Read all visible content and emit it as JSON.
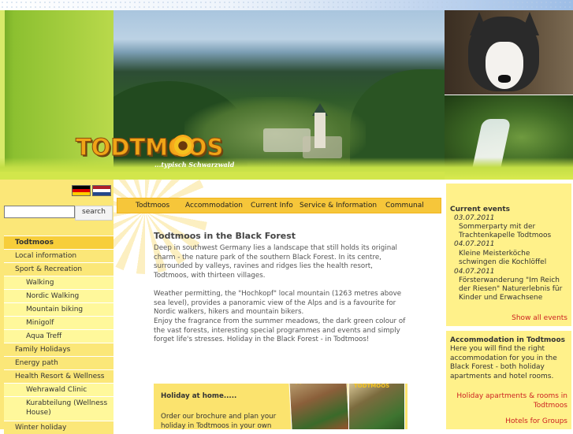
{
  "header": {
    "logo_text": "TODTMOOS",
    "tagline": "...typisch Schwarzwald"
  },
  "languages": [
    {
      "code": "de",
      "label": "German"
    },
    {
      "code": "nl",
      "label": "Dutch"
    }
  ],
  "search": {
    "placeholder": "",
    "button_label": "search"
  },
  "top_nav": [
    "Todtmoos",
    "Accommodation",
    "Current Info",
    "Service & Information",
    "Communal"
  ],
  "side_nav": [
    {
      "label": "Todtmoos",
      "level": 0,
      "active": true
    },
    {
      "label": "Local information",
      "level": 0
    },
    {
      "label": "Sport & Recreation",
      "level": 0
    },
    {
      "label": "Walking",
      "level": 1
    },
    {
      "label": "Nordic Walking",
      "level": 1
    },
    {
      "label": "Mountain biking",
      "level": 1
    },
    {
      "label": "Minigolf",
      "level": 1
    },
    {
      "label": "Aqua Treff",
      "level": 1
    },
    {
      "label": "Family Holidays",
      "level": 0
    },
    {
      "label": "Energy path",
      "level": 0
    },
    {
      "label": "Health Resort & Wellness",
      "level": 0
    },
    {
      "label": "Wehrawald Clinic",
      "level": 1
    },
    {
      "label": "Kurabteilung (Wellness House)",
      "level": 1
    },
    {
      "label": "Winter holiday",
      "level": 0
    }
  ],
  "main": {
    "title": "Todtmoos in the Black Forest",
    "paragraphs": [
      "Deep in southwest Germany lies a landscape that still holds its original charm - the nature park of the southern Black Forest. In its centre, surrounded by valleys, ravines and ridges lies the health resort, Todtmoos, with thirteen villages.",
      "Weather permitting, the \"Hochkopf\" local mountain (1263 metres above sea level), provides a panoramic view of the Alps and is a favourite for Nordic walkers, hikers and mountain bikers.",
      "Enjoy the fragrance from the summer meadows, the dark green colour of the vast forests, interesting special programmes and events and simply forget life's stresses. Holiday in the Black Forest - in Todtmoos!"
    ],
    "holiday_box": {
      "title": "Holiday at home.....",
      "text": "Order our brochure and plan your holiday in Todtmoos in your own time..."
    }
  },
  "events": {
    "heading": "Current events",
    "items": [
      {
        "date": "03.07.2011",
        "title": "Sommerparty mit der Trachtenkapelle Todtmoos"
      },
      {
        "date": "04.07.2011",
        "title": "Kleine Meisterköche schwingen die Kochlöffel"
      },
      {
        "date": "04.07.2011",
        "title": "Försterwanderung \"Im Reich der Riesen\" Naturerlebnis für Kinder und Erwachsene"
      }
    ],
    "show_all": "Show all events"
  },
  "accommodation": {
    "heading": "Accommodation in Todtmoos",
    "text": "Here you will find the right accommodation for you in the Black Forest - both holiday apartments and hotel rooms.",
    "links": [
      "Holiday apartments & rooms in Todtmoos",
      "Hotels for Groups"
    ]
  },
  "colors": {
    "accent_yellow": "#f6c63a",
    "panel_yellow": "#fff18a",
    "link_red": "#cc2222",
    "header_green": "#c3de45"
  }
}
